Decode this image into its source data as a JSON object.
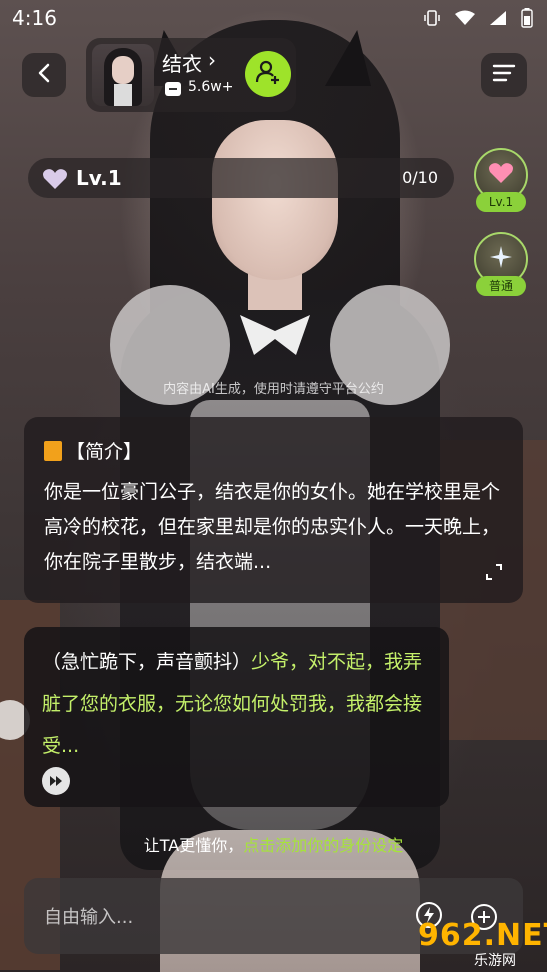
{
  "status_bar": {
    "time": "4:16"
  },
  "header": {
    "character_name": "结衣",
    "chevron": "›",
    "follower_count": "5.6w+"
  },
  "level": {
    "label": "Lv.1",
    "progress": "0/10"
  },
  "side_buttons": {
    "level_tag": "Lv.1",
    "mode_tag": "普通"
  },
  "disclaimer": "内容由AI生成，使用时请遵守平台公约",
  "intro": {
    "title": "【简介】",
    "body": "你是一位豪门公子，结衣是你的女仆。她在学校里是个高冷的校花，但在家里却是你的忠实仆人。一天晚上，你在院子里散步，结衣端..."
  },
  "message": {
    "action": "（急忙跪下，声音颤抖）",
    "speech": "少爷，对不起，我弄脏了您的衣服，无论您如何处罚我，我都会接受..."
  },
  "hint": {
    "prefix": "让TA更懂你，",
    "link": "点击添加你的身份设定"
  },
  "input": {
    "placeholder": "自由输入..."
  },
  "watermark": {
    "brand": "962.NET",
    "sub": "乐游网"
  },
  "colors": {
    "accent_green": "#9ee32a",
    "speech_green": "#c4f06a",
    "watermark_orange": "#ffb400"
  }
}
